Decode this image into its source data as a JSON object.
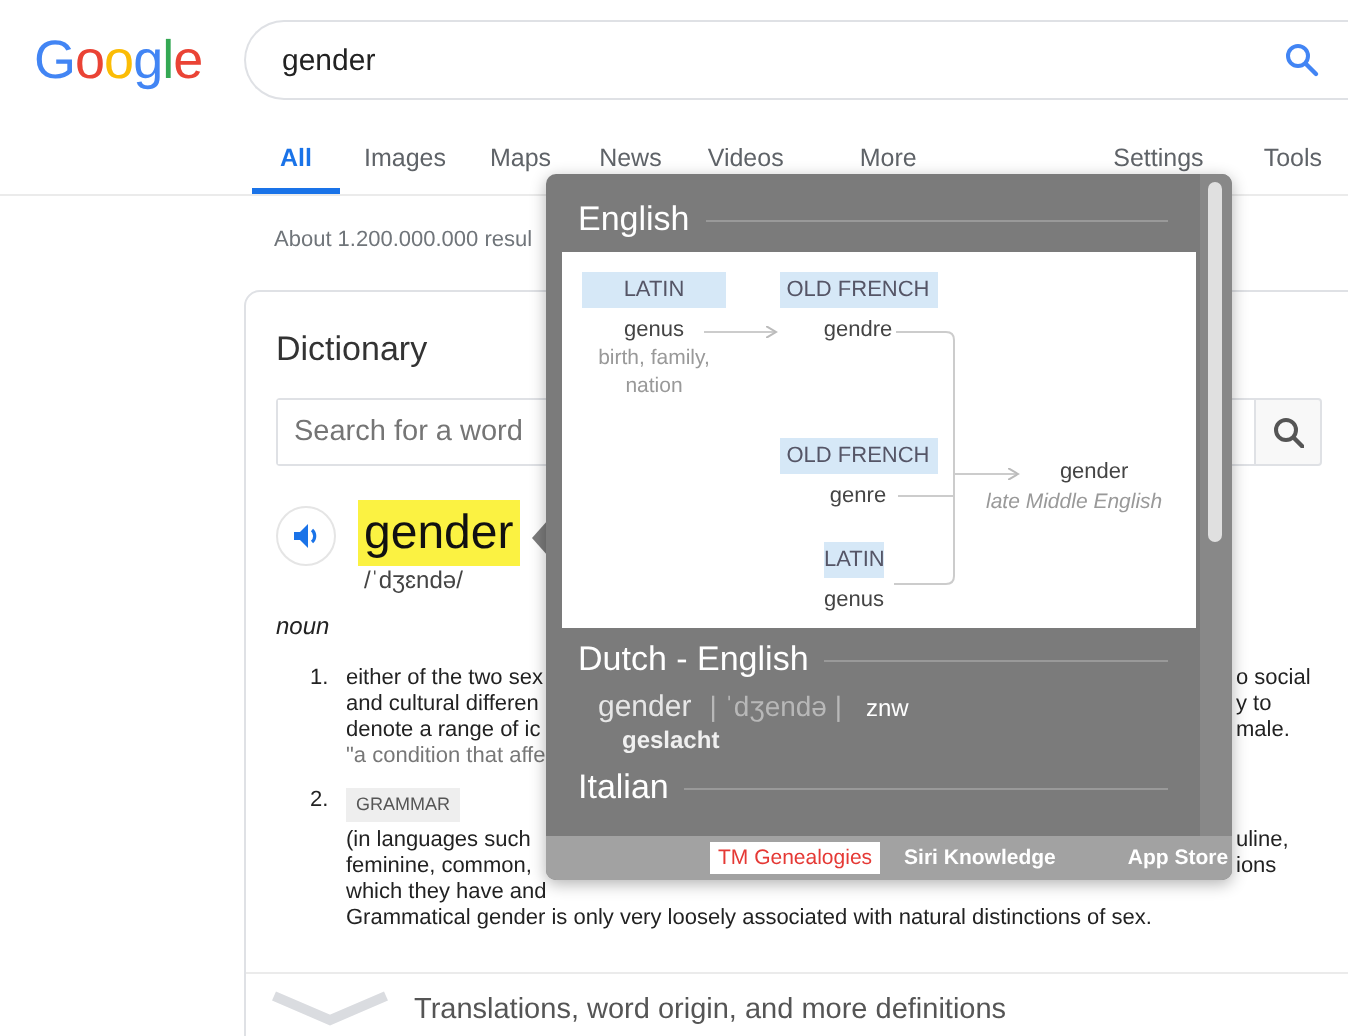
{
  "logo": "Google",
  "search": {
    "value": "gender"
  },
  "tabs": [
    {
      "label": "All",
      "selected": true
    },
    {
      "label": "Images",
      "selected": false
    },
    {
      "label": "Maps",
      "selected": false
    },
    {
      "label": "News",
      "selected": false
    },
    {
      "label": "Videos",
      "selected": false
    },
    {
      "label": "More",
      "selected": false
    }
  ],
  "tools": [
    "Settings",
    "Tools"
  ],
  "result_stats": "About 1.200.000.000 resul",
  "dictionary": {
    "title": "Dictionary",
    "search": {
      "placeholder": "Search for a word"
    },
    "headword": "gender",
    "pronunciation": "/ˈdʒɛndə/",
    "part_of_speech": "noun",
    "senses": [
      {
        "number": "1.",
        "lines": [
          {
            "left": "either of the two sex",
            "right": "o social"
          },
          {
            "left": "and cultural differen",
            "right": "y to"
          },
          {
            "left": "denote a range of ic",
            "right": "male."
          }
        ],
        "example": "\"a condition that affe"
      },
      {
        "number": "2.",
        "tag": "GRAMMAR",
        "lines": [
          {
            "left": "(in languages such",
            "right": "uline,"
          },
          {
            "left": "feminine, common,",
            "right": "ions"
          },
          {
            "left": "which they have and"
          },
          {
            "left": "Grammatical gender is only very loosely associated with natural distinctions of sex."
          }
        ]
      }
    ],
    "more": "Translations, word origin, and more definitions"
  },
  "popup": {
    "sections": [
      {
        "kind": "etymology",
        "title": "English",
        "nodes": [
          {
            "language": "LATIN",
            "word": "genus",
            "gloss": "birth, family, nation"
          },
          {
            "language": "OLD FRENCH",
            "word": "gendre"
          },
          {
            "language": "OLD FRENCH",
            "word": "genre"
          },
          {
            "language": "LATIN",
            "word": "genus"
          }
        ],
        "result": {
          "word": "gender",
          "note": "late Middle English"
        }
      },
      {
        "kind": "translation",
        "title": "Dutch - English",
        "word": "gender",
        "pronunciation": "| ˈdʒendə |",
        "pos": "znw",
        "translation": "geslacht"
      },
      {
        "kind": "heading",
        "title": "Italian"
      }
    ],
    "sources": [
      {
        "label": "TM Genealogies",
        "selected": true
      },
      {
        "label": "Siri Knowledge",
        "selected": false
      },
      {
        "label": "App Store",
        "selected": false
      }
    ]
  }
}
